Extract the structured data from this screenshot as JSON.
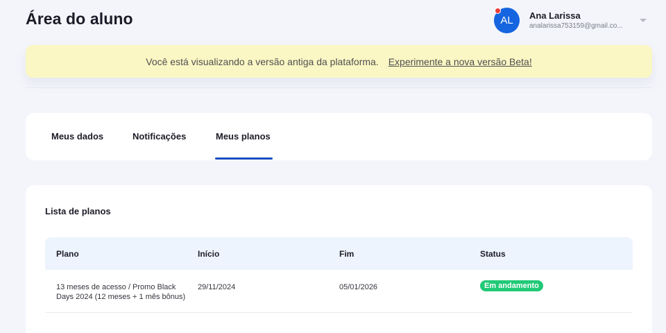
{
  "header": {
    "title": "Área do aluno",
    "user": {
      "initials": "AL",
      "name": "Ana Larissa",
      "email": "analarissa753159@gmail.co..."
    }
  },
  "banner": {
    "message": "Você está visualizando a versão antiga da plataforma.",
    "link_label": "Experimente a nova versão Beta!"
  },
  "tabs": [
    {
      "label": "Meus dados",
      "active": false
    },
    {
      "label": "Notificações",
      "active": false
    },
    {
      "label": "Meus planos",
      "active": true
    }
  ],
  "plans": {
    "title": "Lista de planos",
    "columns": [
      "Plano",
      "Início",
      "Fim",
      "Status"
    ],
    "rows": [
      {
        "plan": "13 meses de acesso / Promo Black Days 2024 (12 meses + 1 mês bônus)",
        "start": "29/11/2024",
        "end": "05/01/2026",
        "status": "Em andamento"
      }
    ]
  },
  "colors": {
    "accent": "#1a4fc4",
    "avatar": "#1565e0",
    "notification_dot": "#ef3b3b",
    "banner_bg": "#fbf7c4",
    "status_success": "#22c977"
  }
}
